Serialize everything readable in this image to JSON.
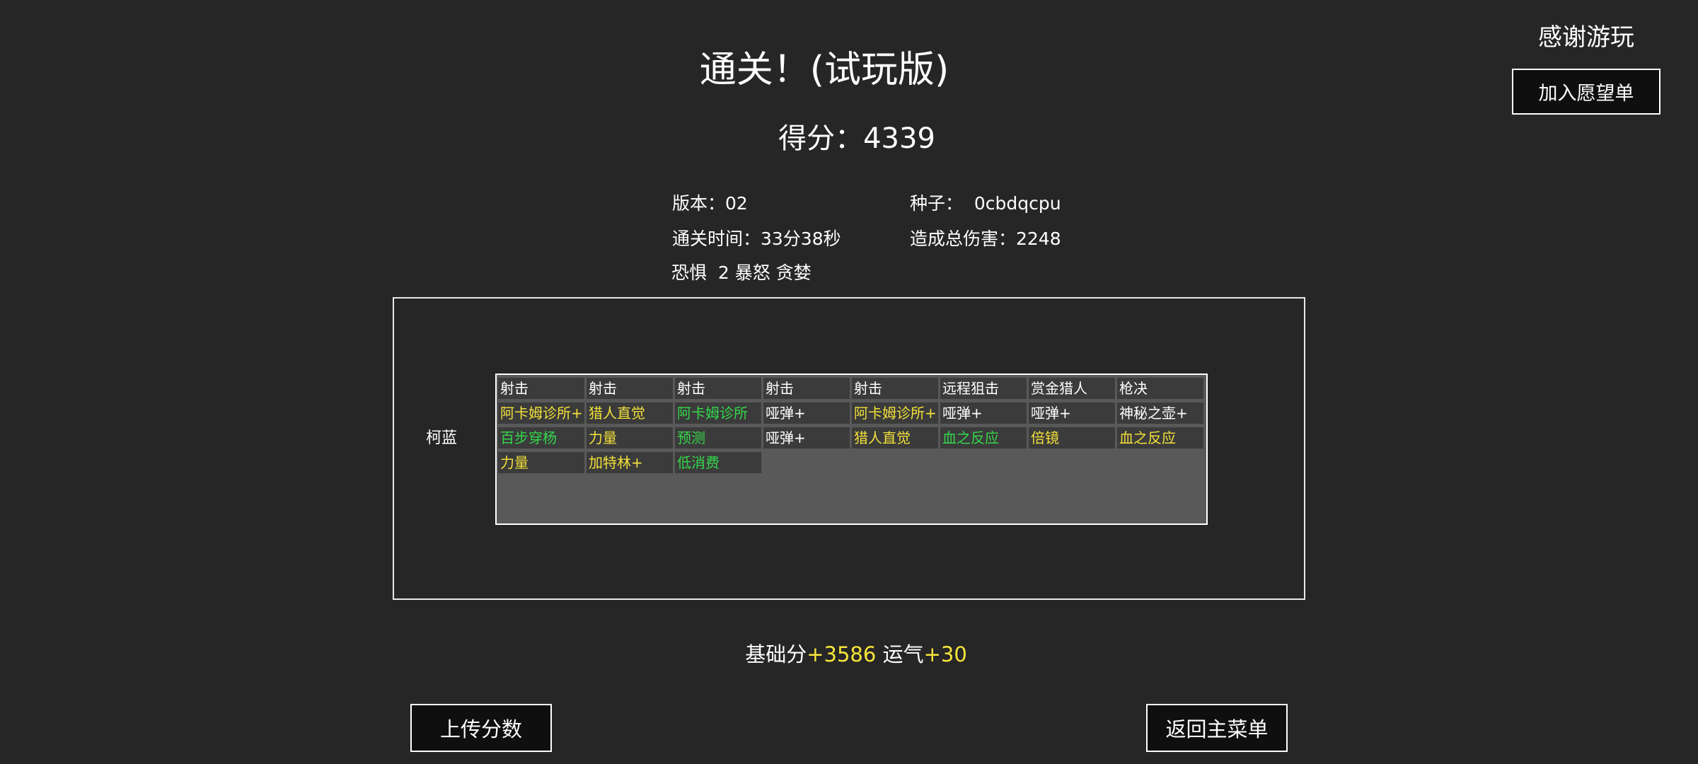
{
  "title": "通关！(试玩版)",
  "score_line": "得分：4339",
  "info": {
    "version": "版本：02",
    "seed": "种子：  0cbdqcpu",
    "clear_time": "通关时间：33分38秒",
    "total_damage": "造成总伤害：2248",
    "difficulty": "恐惧  2 暴怒 贪婪"
  },
  "side": {
    "thanks": "感谢游玩",
    "wishlist_button": "加入愿望单"
  },
  "character": {
    "name": "柯蓝"
  },
  "columns": [
    {
      "header": "射击",
      "items": [
        {
          "text": "阿卡姆诊所+",
          "color": "yellow"
        },
        {
          "text": "百步穿杨",
          "color": "green"
        },
        {
          "text": "力量",
          "color": "yellow"
        }
      ]
    },
    {
      "header": "射击",
      "items": [
        {
          "text": "猎人直觉",
          "color": "yellow"
        },
        {
          "text": "力量",
          "color": "yellow"
        },
        {
          "text": "加特林+",
          "color": "yellow"
        }
      ]
    },
    {
      "header": "射击",
      "items": [
        {
          "text": "阿卡姆诊所",
          "color": "green"
        },
        {
          "text": "预测",
          "color": "green"
        },
        {
          "text": "低消费",
          "color": "green"
        }
      ]
    },
    {
      "header": "射击",
      "items": [
        {
          "text": "哑弹+",
          "color": "white"
        },
        {
          "text": "哑弹+",
          "color": "white"
        }
      ]
    },
    {
      "header": "射击",
      "items": [
        {
          "text": "阿卡姆诊所+",
          "color": "yellow"
        },
        {
          "text": "猎人直觉",
          "color": "yellow"
        }
      ]
    },
    {
      "header": "远程狙击",
      "items": [
        {
          "text": "哑弹+",
          "color": "white"
        },
        {
          "text": "血之反应",
          "color": "green"
        }
      ]
    },
    {
      "header": "赏金猎人",
      "items": [
        {
          "text": "哑弹+",
          "color": "white"
        },
        {
          "text": "倍镜",
          "color": "yellow"
        }
      ]
    },
    {
      "header": "枪决",
      "items": [
        {
          "text": "神秘之壶+",
          "color": "white"
        },
        {
          "text": "血之反应",
          "color": "yellow"
        }
      ]
    }
  ],
  "bonus": {
    "base_label": "基础分",
    "base_value": "+3586",
    "luck_label": "运气",
    "luck_value": "+30"
  },
  "buttons": {
    "upload": "上传分数",
    "main_menu": "返回主菜单"
  },
  "colors": {
    "background": "#262626",
    "white": "#ffffff",
    "yellow": "#f2e03a",
    "green": "#33d84a"
  }
}
